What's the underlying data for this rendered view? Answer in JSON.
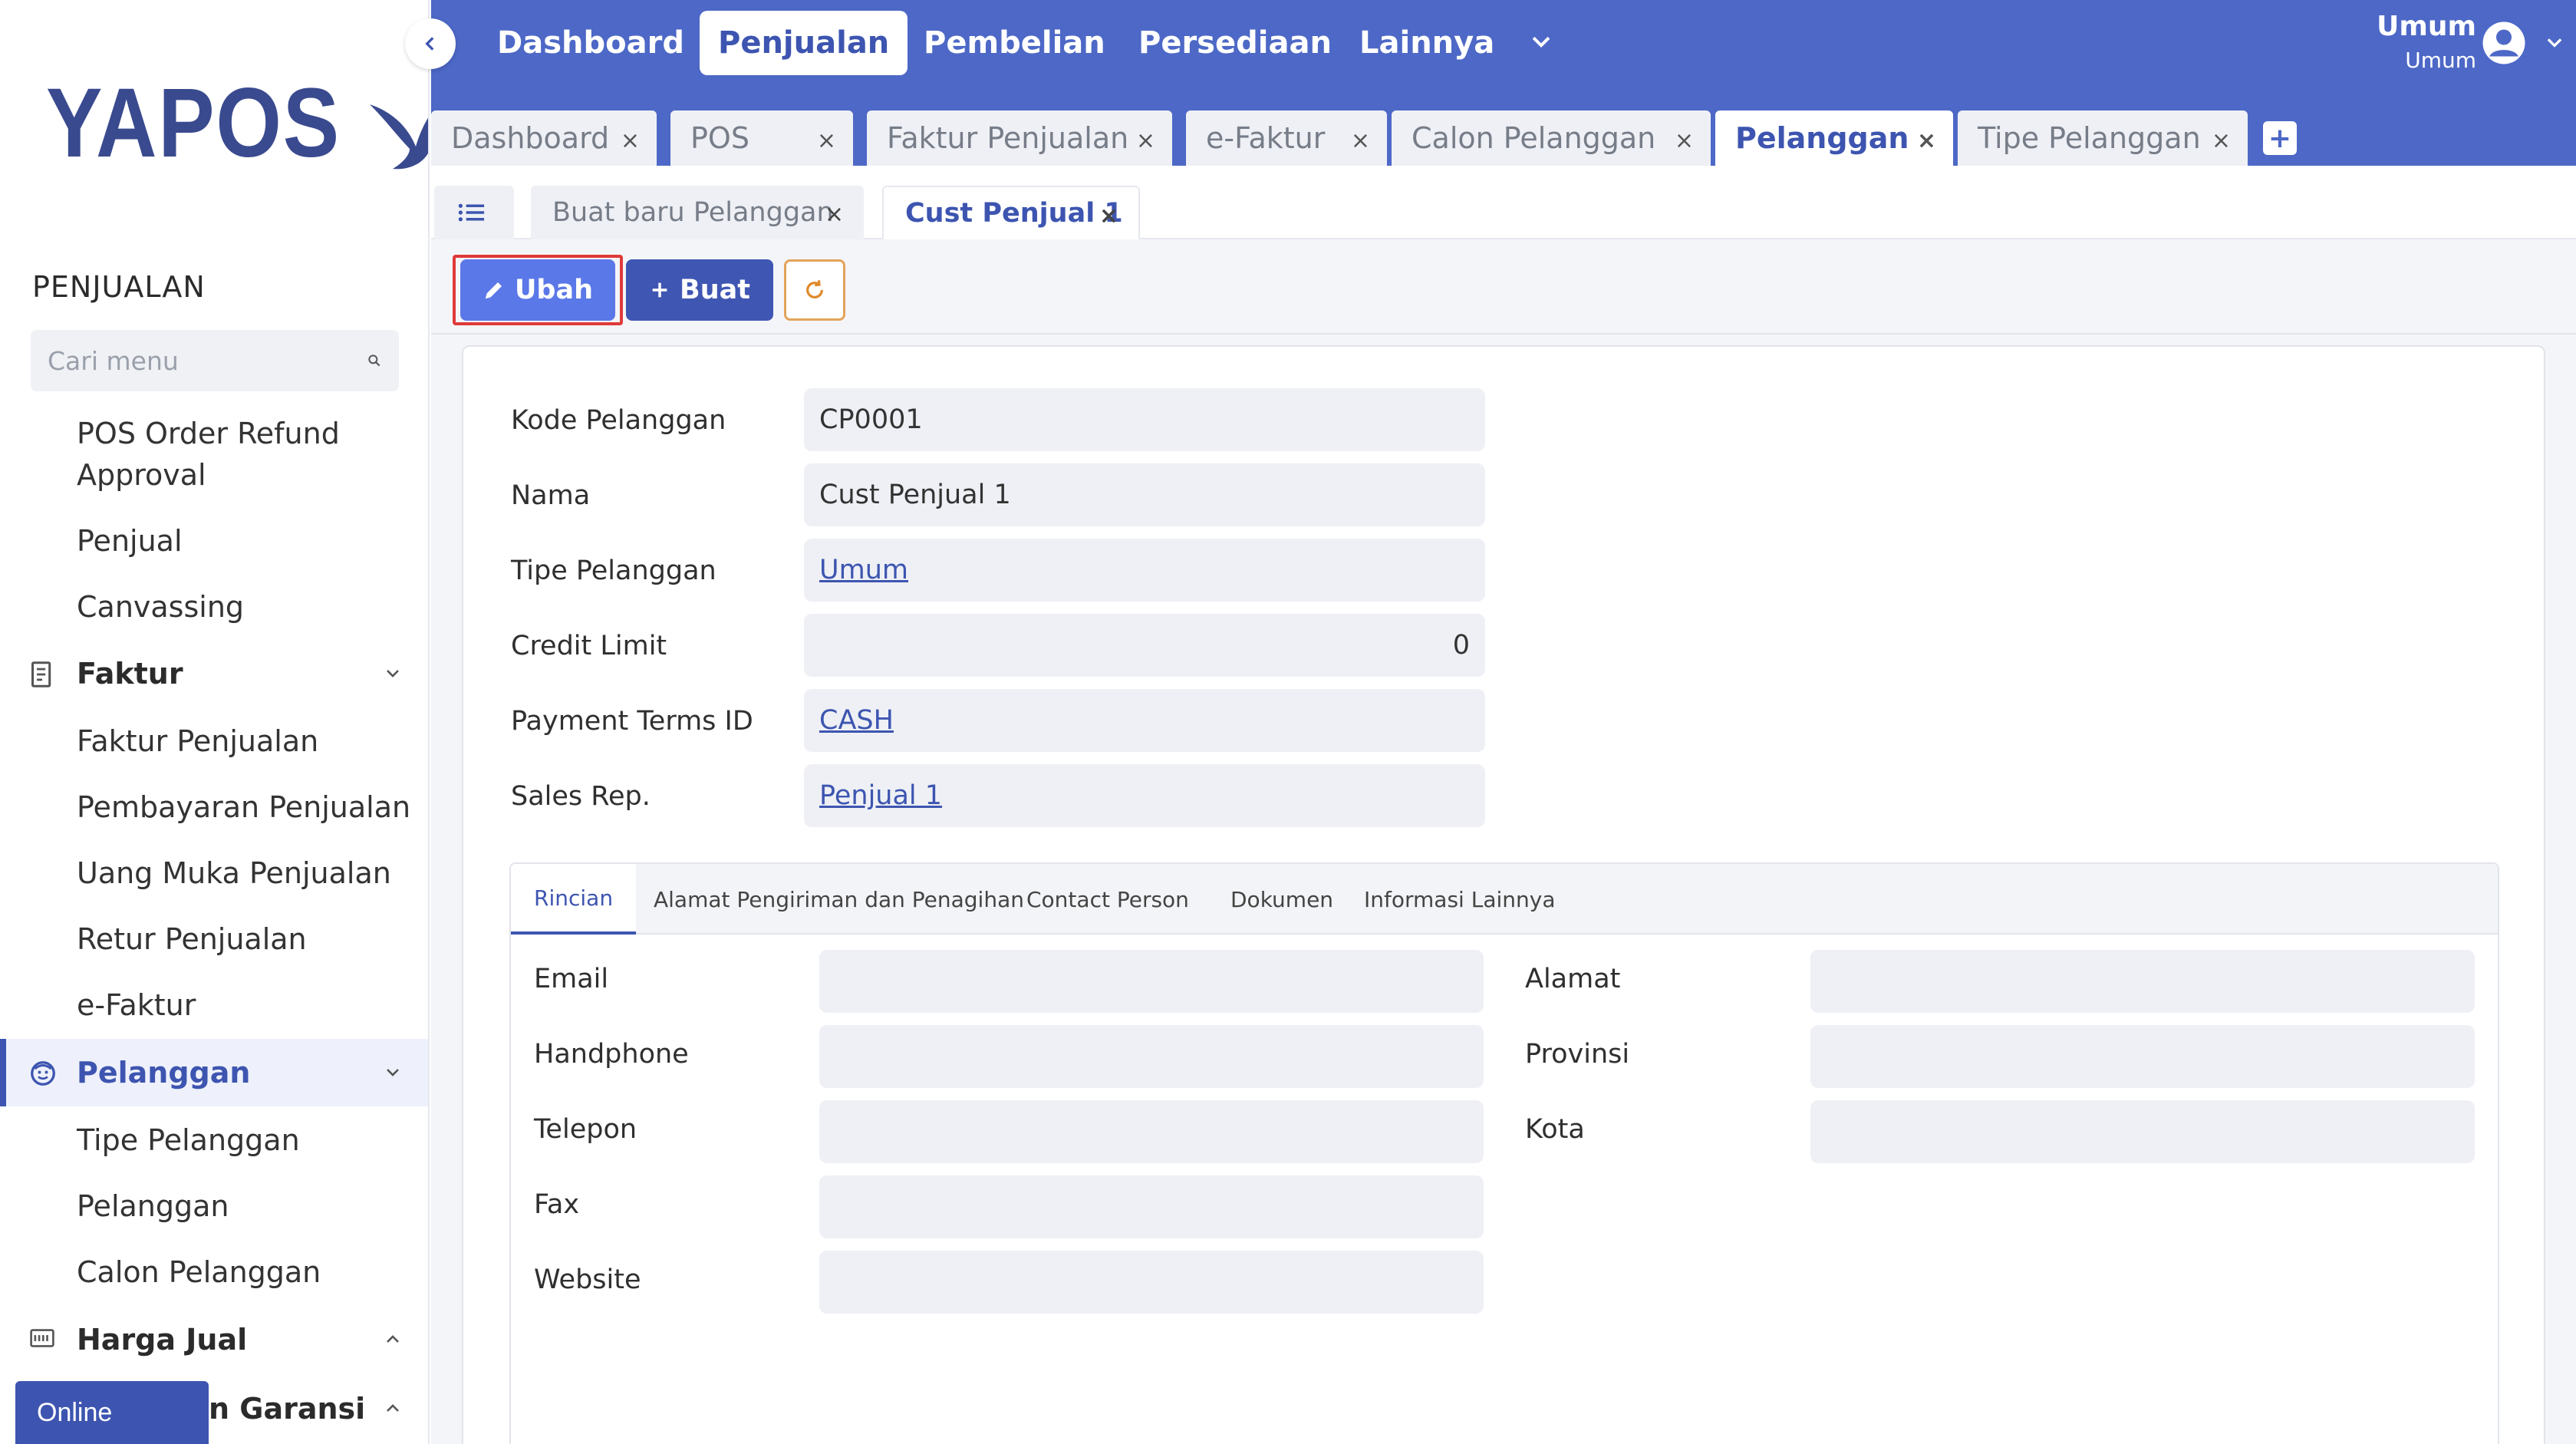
{
  "logo": {
    "text": "YAPOS"
  },
  "sidebar": {
    "section_title": "PENJUALAN",
    "search_placeholder": "Cari menu",
    "items_top": [
      "POS Order Refund",
      "Approval",
      "Penjual",
      "Canvassing"
    ],
    "group_faktur": "Faktur",
    "faktur_items": [
      "Faktur Penjualan",
      "Pembayaran Penjualan",
      "Uang Muka Penjualan",
      "Retur Penjualan",
      "e-Faktur"
    ],
    "group_pelanggan": "Pelanggan",
    "pelanggan_items": [
      "Tipe Pelanggan",
      "Pelanggan",
      "Calon Pelanggan"
    ],
    "group_harga": "Harga Jual",
    "group_garansi": "n Garansi",
    "online_badge": "Online"
  },
  "topnav": {
    "items": [
      "Dashboard",
      "Penjualan",
      "Pembelian",
      "Persediaan",
      "Lainnya"
    ],
    "active": "Penjualan",
    "user_name": "Umum",
    "user_role": "Umum"
  },
  "tabs": [
    "Dashboard",
    "POS",
    "Faktur Penjualan",
    "e-Faktur",
    "Calon Pelanggan",
    "Pelanggan",
    "Tipe Pelanggan"
  ],
  "tab_add_label": "+",
  "subtabs": [
    "Buat baru Pelanggan",
    "Cust Penjual 1"
  ],
  "close_glyph": "×",
  "toolbar": {
    "edit_label": "Ubah",
    "create_label": "Buat"
  },
  "form": {
    "kode_label": "Kode Pelanggan",
    "kode_value": "CP0001",
    "nama_label": "Nama",
    "nama_value": "Cust Penjual 1",
    "tipe_label": "Tipe Pelanggan",
    "tipe_value": "Umum",
    "credit_label": "Credit Limit",
    "credit_value": "0",
    "payment_label": "Payment Terms ID",
    "payment_value": "CASH",
    "sales_label": "Sales Rep.",
    "sales_value": "Penjual 1"
  },
  "detail_tabs": [
    "Rincian",
    "Alamat Pengiriman dan Penagihan",
    "Contact Person",
    "Dokumen",
    "Informasi Lainnya"
  ],
  "detail": {
    "left_fields": [
      "Email",
      "Handphone",
      "Telepon",
      "Fax",
      "Website"
    ],
    "right_fields": [
      "Alamat",
      "Provinsi",
      "Kota"
    ]
  },
  "colors": {
    "primary": "#4d68c6",
    "accent": "#3d55b0",
    "edit_button": "#5b78e8",
    "highlight": "#e03a3a"
  }
}
